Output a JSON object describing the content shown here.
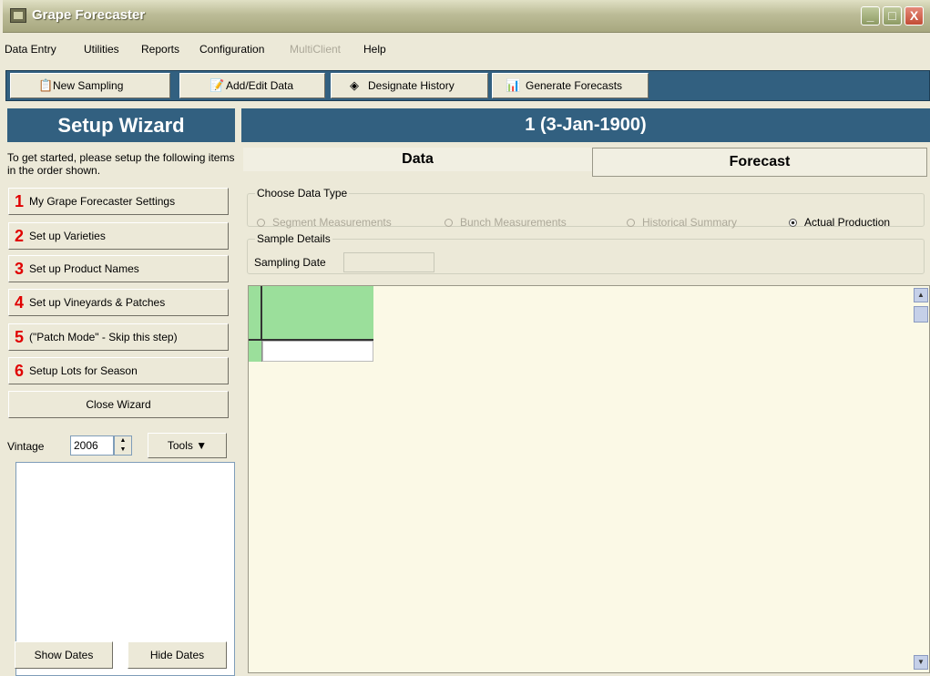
{
  "window": {
    "title": "Grape Forecaster",
    "min": "_",
    "max": "□",
    "close": "X"
  },
  "menu": [
    "Data Entry",
    "Utilities",
    "Reports",
    "Configuration",
    "MultiClient",
    "Help"
  ],
  "toolbar": {
    "new_sampling": "New Sampling",
    "add_edit": "Add/Edit Data",
    "designate": "Designate History",
    "generate": "Generate Forecasts"
  },
  "wizard": {
    "title": "Setup Wizard",
    "intro": "To get started, please setup the following items in the order shown.",
    "steps": [
      {
        "num": "1",
        "label": "My Grape Forecaster Settings"
      },
      {
        "num": "2",
        "label": "Set up Varieties"
      },
      {
        "num": "3",
        "label": "Set up Product Names"
      },
      {
        "num": "4",
        "label": "Set up Vineyards & Patches"
      },
      {
        "num": "5",
        "label": "(\"Patch Mode\" - Skip this step)"
      },
      {
        "num": "6",
        "label": "Setup Lots for Season"
      }
    ],
    "close": "Close Wizard"
  },
  "vintage": {
    "label": "Vintage",
    "value": "2006"
  },
  "tools": "Tools ▼",
  "dates": {
    "show": "Show Dates",
    "hide": "Hide Dates"
  },
  "main": {
    "header": "1 (3-Jan-1900)",
    "tabs": {
      "data": "Data",
      "forecast": "Forecast"
    },
    "data_type": {
      "legend": "Choose Data Type",
      "options": [
        "Segment Measurements",
        "Bunch Measurements",
        "Historical Summary",
        "Actual Production"
      ],
      "selected": "Actual Production"
    },
    "sample": {
      "legend": "Sample Details",
      "date_label": "Sampling Date",
      "date_value": ""
    }
  },
  "colors": {
    "accent": "#326080",
    "step_number": "#e00000",
    "grid_header": "#9bdf9b"
  }
}
